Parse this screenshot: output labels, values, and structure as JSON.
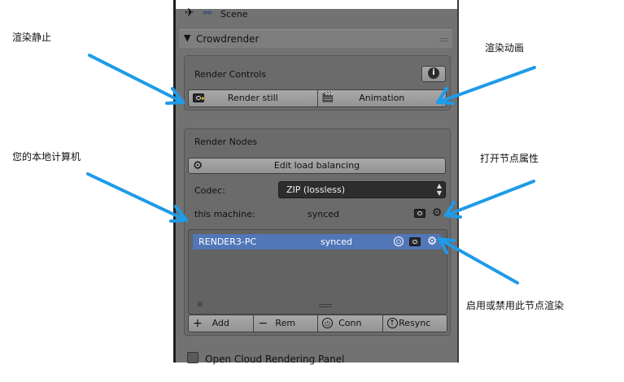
{
  "scene": {
    "label": "Scene"
  },
  "panel": {
    "title": "Crowdrender"
  },
  "render_controls": {
    "title": "Render Controls",
    "render_still_label": "Render still",
    "animation_label": "Animation"
  },
  "render_nodes": {
    "title": "Render Nodes",
    "edit_load_balancing_label": "Edit load balancing",
    "codec_label": "Codec:",
    "codec_value": "ZIP (lossless)",
    "this_machine_label": "this machine:",
    "this_machine_status": "synced",
    "nodes": [
      {
        "name": "RENDER3-PC",
        "status": "synced"
      }
    ],
    "actions": {
      "add": "Add",
      "rem": "Rem",
      "conn": "Conn",
      "resync": "Resync"
    }
  },
  "cloud_panel": {
    "label": "Open Cloud Rendering Panel"
  },
  "annotations": {
    "render_still": "渲染静止",
    "render_animation": "渲染动画",
    "your_computer": "您的本地计算机",
    "open_node_props": "打开节点属性",
    "enable_disable_node": "启用或禁用此节点渲染"
  },
  "colors": {
    "arrow": "#1e9be9",
    "selected_row": "#5177b8",
    "panel_bg": "#727272"
  }
}
